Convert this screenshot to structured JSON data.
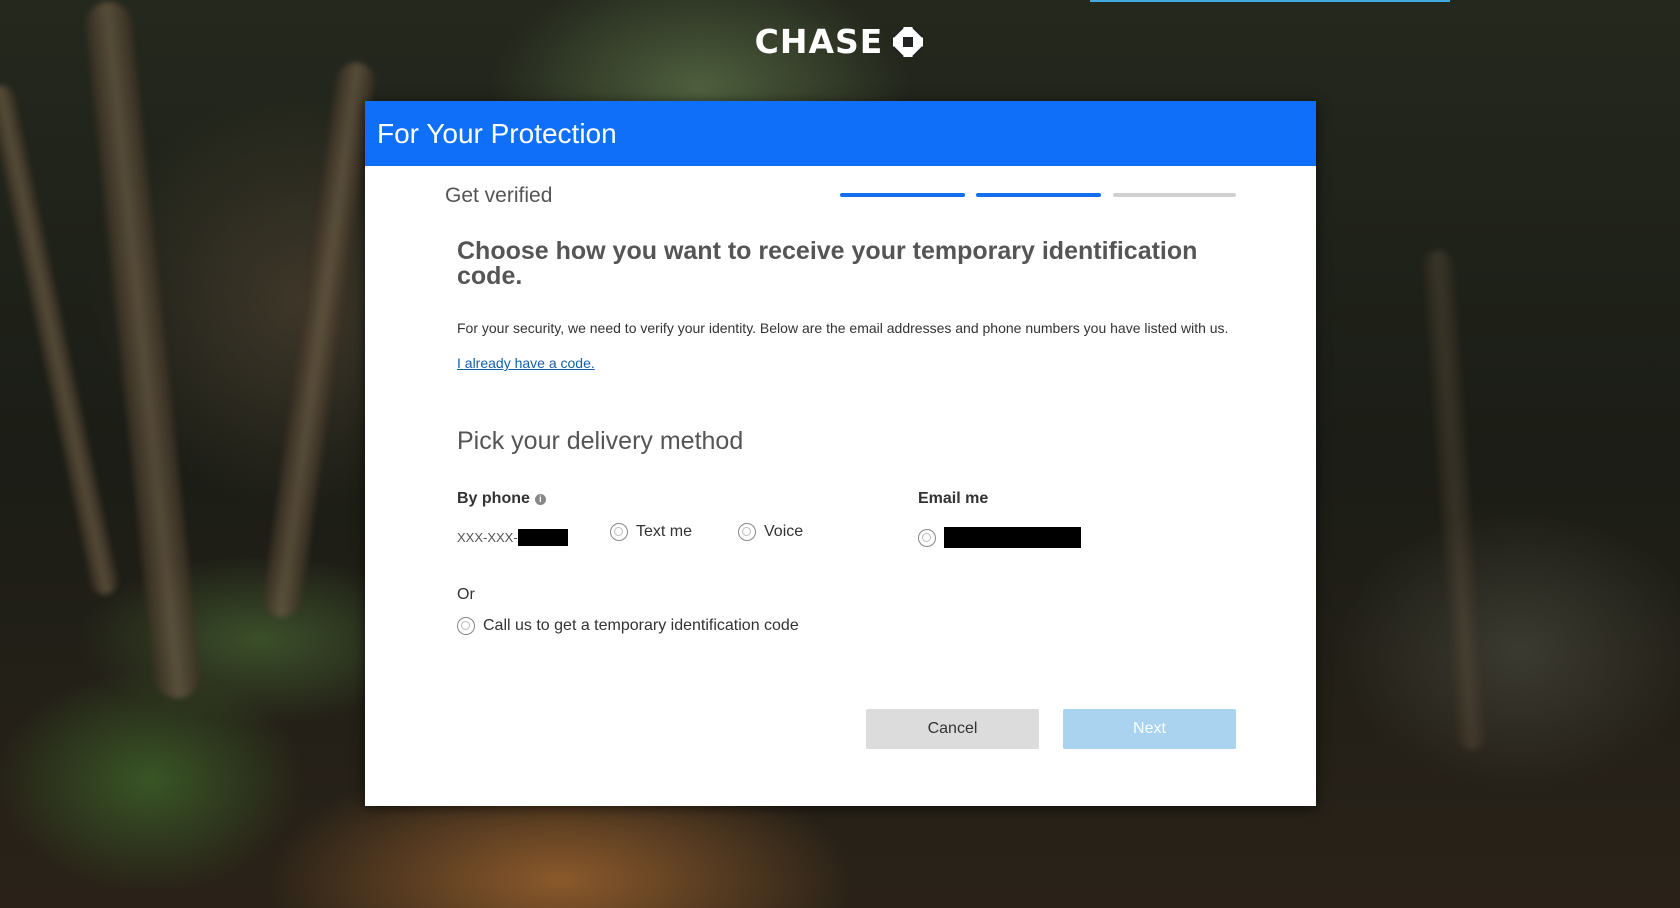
{
  "brand": {
    "name": "CHASE",
    "logo_icon": "chase-octagon-icon"
  },
  "modal": {
    "title": "For Your Protection",
    "step_label": "Get verified",
    "progress_steps_completed": 2,
    "progress_steps_total": 3
  },
  "content": {
    "heading": "Choose how you want to receive your temporary identification code.",
    "description": "For your security, we need to verify your identity. Below are the email addresses and phone numbers you have listed with us.",
    "have_code_link": "I already have a code.",
    "delivery_heading": "Pick your delivery method"
  },
  "phone": {
    "title": "By phone",
    "info_icon": "info-icon",
    "number_prefix": "XXX-XXX-",
    "text_option": "Text me",
    "voice_option": "Voice"
  },
  "email": {
    "title": "Email me"
  },
  "or_label": "Or",
  "call_option": "Call us to get a temporary identification code",
  "buttons": {
    "cancel": "Cancel",
    "next": "Next"
  },
  "colors": {
    "header_blue": "#0f6ff8",
    "next_disabled": "#a9d3ef",
    "link": "#1460aa"
  }
}
